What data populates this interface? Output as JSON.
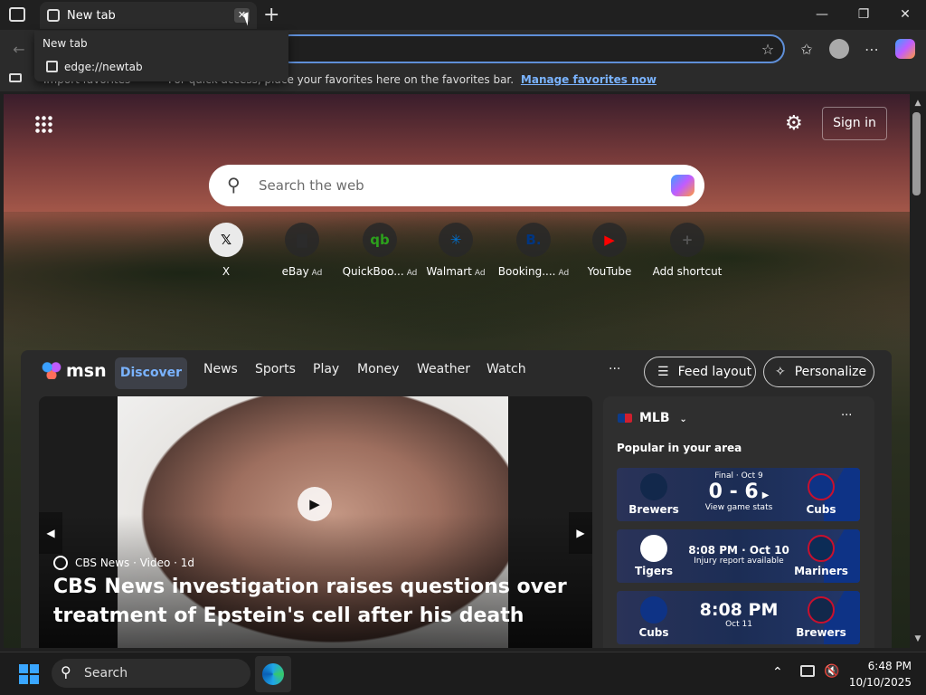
{
  "browser": {
    "tab_title": "New tab",
    "tab_tooltip_title": "New tab",
    "tab_tooltip_url": "edge://newtab"
  },
  "favorites_bar": {
    "partial_left": "Import favorites",
    "message": "For quick access, place your favorites here on the favorites bar.",
    "manage_link": "Manage favorites now"
  },
  "header": {
    "sign_in": "Sign in"
  },
  "search": {
    "placeholder": "Search the web"
  },
  "shortcuts": [
    {
      "label": "X",
      "ad": "",
      "icon": "x-icon",
      "glyph": "𝕏",
      "color": "#000000"
    },
    {
      "label": "eBay",
      "ad": "Ad",
      "icon": "ebay-icon",
      "glyph": "▇",
      "color": "#2b2b2b"
    },
    {
      "label": "QuickBoo...",
      "ad": "Ad",
      "icon": "quickbooks-icon",
      "glyph": "qb",
      "color": "#2ca01c"
    },
    {
      "label": "Walmart",
      "ad": "Ad",
      "icon": "walmart-icon",
      "glyph": "✳",
      "color": "#0071ce"
    },
    {
      "label": "Booking....",
      "ad": "Ad",
      "icon": "booking-icon",
      "glyph": "B.",
      "color": "#003580"
    },
    {
      "label": "YouTube",
      "ad": "",
      "icon": "youtube-icon",
      "glyph": "▶",
      "color": "#ff0000"
    },
    {
      "label": "Add shortcut",
      "ad": "",
      "icon": "plus-icon",
      "glyph": "+",
      "color": "#555555"
    }
  ],
  "msn": {
    "logo": "msn",
    "nav": [
      "Discover",
      "News",
      "Sports",
      "Play",
      "Money",
      "Weather",
      "Watch"
    ],
    "more": "···",
    "feed_layout": "Feed layout",
    "personalize": "Personalize"
  },
  "hero": {
    "source": "CBS News · Video · 1d",
    "headline_line1": "CBS News investigation raises questions over",
    "headline_line2": "treatment of Epstein's cell after his death"
  },
  "sports": {
    "league": "MLB",
    "subtitle": "Popular in your area",
    "more": "···",
    "games": [
      {
        "home": "Brewers",
        "away": "Cubs",
        "status": "Final · Oct 9",
        "score": "0 - 6",
        "detail": "View game stats",
        "home_color": "#12284b",
        "away_color": "#0e3386"
      },
      {
        "home": "Tigers",
        "away": "Mariners",
        "status": "8:08 PM · Oct 10",
        "score": "",
        "detail": "Injury report available",
        "home_color": "#ffffff",
        "away_color": "#0c2c56"
      },
      {
        "home": "Cubs",
        "away": "Brewers",
        "status": "8:08 PM",
        "score": "",
        "detail": "Oct 11",
        "home_color": "#0e3386",
        "away_color": "#12284b"
      }
    ]
  },
  "taskbar": {
    "search": "Search",
    "time": "6:48 PM",
    "date": "10/10/2025"
  }
}
